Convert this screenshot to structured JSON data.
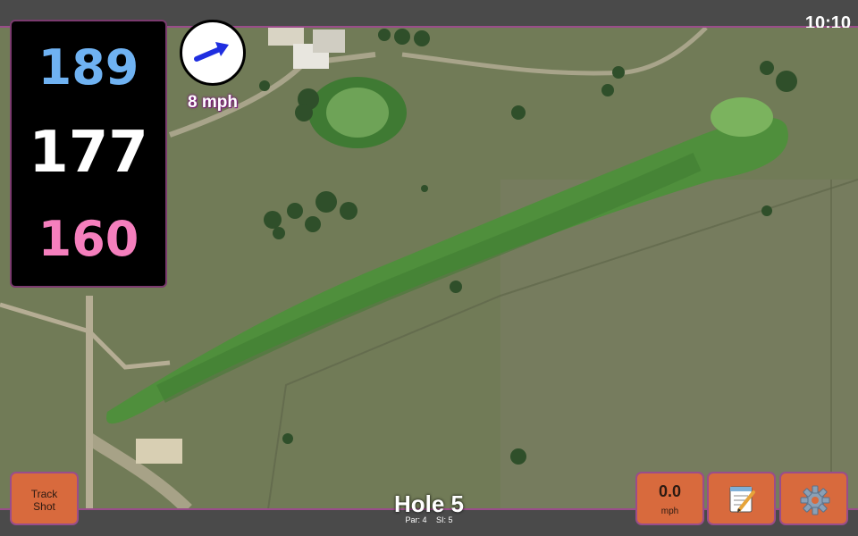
{
  "status_bar": {
    "time": "10:10"
  },
  "yardages": {
    "back": "189",
    "middle": "177",
    "front": "160"
  },
  "wind": {
    "speed": "8 mph",
    "icon": "arrow-icon"
  },
  "hole": {
    "title": "Hole 5",
    "par": "Par: 4",
    "stroke_index": "SI: 5"
  },
  "buttons": {
    "track_shot_line1": "Track",
    "track_shot_line2": "Shot",
    "speed_value": "0.0",
    "speed_unit": "mph",
    "notes_icon": "notepad-icon",
    "settings_icon": "gear-icon"
  },
  "colors": {
    "back_yardage": "#6fb2f2",
    "middle_yardage": "#ffffff",
    "front_yardage": "#f57fbd",
    "button_bg": "#d86a3d",
    "accent_border": "#9a4d8a"
  }
}
